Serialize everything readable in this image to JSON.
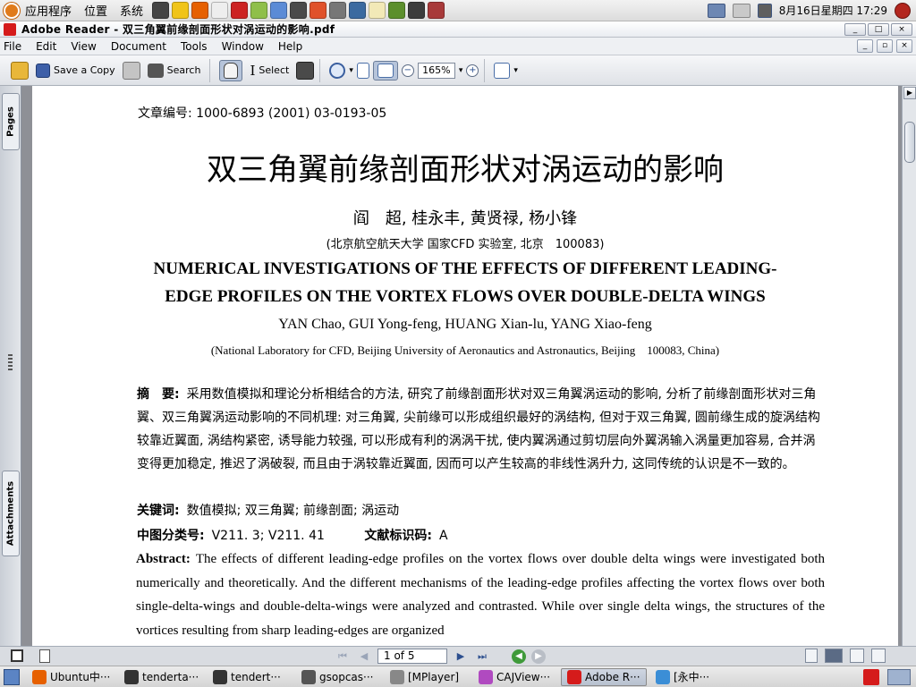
{
  "top_panel": {
    "menus": [
      "应用程序",
      "位置",
      "系统"
    ],
    "clock": "8月16日星期四 17:29",
    "launcher_colors": [
      "#444444",
      "#f0c419",
      "#e66000",
      "#eeeeee",
      "#cc2222",
      "#8fbf4a",
      "#5b8bd6",
      "#4a4a4a",
      "#e0522a",
      "#777777",
      "#3b6aa0",
      "#f2e9b7",
      "#5c8f2c",
      "#3c3c3c",
      "#a83a3a"
    ]
  },
  "window": {
    "title": "Adobe Reader - 双三角翼前缘剖面形状对涡运动的影响.pdf",
    "controls": [
      "_",
      "□",
      "×"
    ]
  },
  "menubar": {
    "items": [
      "File",
      "Edit",
      "View",
      "Document",
      "Tools",
      "Window",
      "Help"
    ],
    "doc_controls": [
      "_",
      "▫",
      "×"
    ]
  },
  "toolbar": {
    "save_label": "Save a Copy",
    "search_label": "Search",
    "select_label": "Select",
    "zoom_value": "165%"
  },
  "sidebar": {
    "pages_tab": "Pages",
    "attachments_tab": "Attachments"
  },
  "doc": {
    "article_number": "文章编号: 1000-6893 (2001) 03-0193-05",
    "cn_title": "双三角翼前缘剖面形状对涡运动的影响",
    "cn_authors": "阎　超, 桂永丰, 黄贤禄, 杨小锋",
    "cn_affiliation": "(北京航空航天大学 国家CFD 实验室, 北京　100083)",
    "en_title_line1": "NUMERICAL  INVESTIGATIONS OF THE EFFECTS OF DIFFERENT LEADING-",
    "en_title_line2": "EDGE PROFILES ON THE VORTEX FLOWS OVER DOUBLE-DELTA WINGS",
    "en_authors": "YAN Chao,  GUI Yong-feng,  HUANG Xian-lu,  YANG Xiao-feng",
    "en_affiliation": "(National Laboratory for CFD,  Beijing University of Aeronautics and Astronautics,  Beijing　100083,  China)",
    "abstract_label": "摘　要:",
    "abstract_text": "采用数值模拟和理论分析相结合的方法, 研究了前缘剖面形状对双三角翼涡运动的影响, 分析了前缘剖面形状对三角翼、双三角翼涡运动影响的不同机理: 对三角翼, 尖前缘可以形成组织最好的涡结构, 但对于双三角翼, 圆前缘生成的旋涡结构较靠近翼面, 涡结构紧密, 诱导能力较强, 可以形成有利的涡涡干扰, 使内翼涡通过剪切层向外翼涡输入涡量更加容易, 合并涡变得更加稳定, 推迟了涡破裂, 而且由于涡较靠近翼面, 因而可以产生较高的非线性涡升力, 这同传统的认识是不一致的。",
    "keywords_label": "关键词:",
    "keywords": "数值模拟;  双三角翼;  前缘剖面;  涡运动",
    "clc_label": "中图分类号:",
    "clc_value": "V211. 3;  V211. 41",
    "doc_code_label": "文献标识码:",
    "doc_code_value": "A",
    "en_abstract_label": "Abstract:",
    "en_abstract_text": "The effects of different leading-edge profiles on the vortex flows over double delta wings were investigated both numerically and theoretically. And the different mechanisms of the leading-edge profiles affecting the vortex flows over both single-delta-wings and double-delta-wings were analyzed and contrasted. While over single delta wings,  the structures of the vortices resulting from sharp leading-edges are organized"
  },
  "statusbar": {
    "page_field": "1 of 5"
  },
  "taskbar": {
    "tasks": [
      {
        "label": "Ubuntu中···",
        "color": "#e66000"
      },
      {
        "label": "tenderta···",
        "color": "#333333"
      },
      {
        "label": "tendert···",
        "color": "#333333"
      },
      {
        "label": "gsopcas···",
        "color": "#555555"
      },
      {
        "label": "[MPlayer]",
        "color": "#888888"
      },
      {
        "label": "CAJView···",
        "color": "#b04ac0"
      },
      {
        "label": "Adobe R···",
        "color": "#d51b1b"
      },
      {
        "label": "[永中···",
        "color": "#3b8ed6"
      }
    ]
  }
}
